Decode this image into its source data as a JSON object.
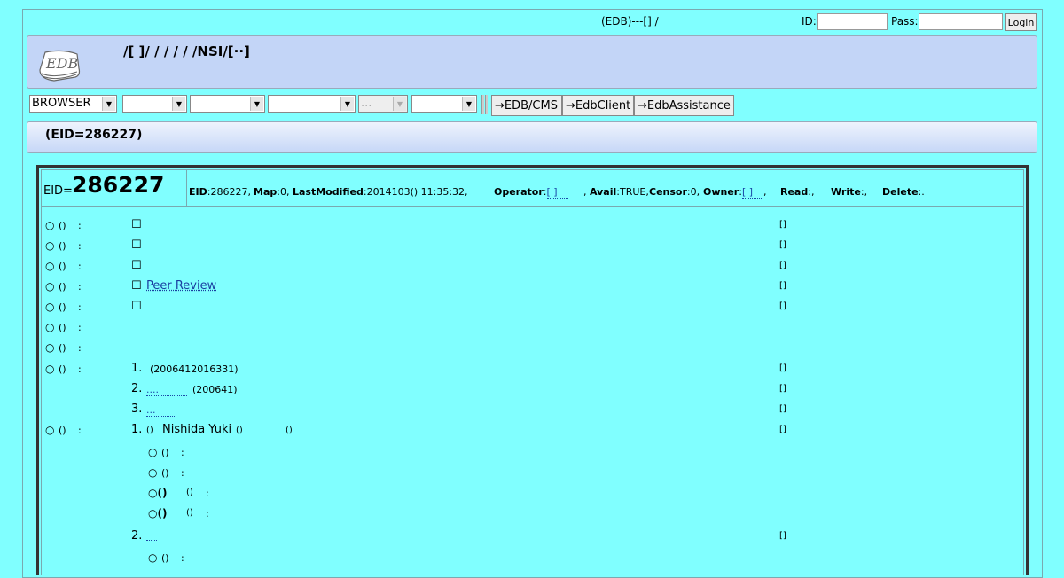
{
  "topbar": {
    "title": "(EDB)---[] /",
    "id_label": "ID:",
    "pass_label": "Pass:",
    "id_value": "",
    "pass_value": "",
    "login_label": "Login"
  },
  "header": {
    "logo_text": "EDB",
    "breadcrumb": "/[ ]/ / / / / /NSI/[··]"
  },
  "menubar": {
    "browser_select": "BROWSER",
    "select2": "",
    "select3": "",
    "select4": "",
    "select5": "...",
    "select6": "",
    "btn_cms": "→EDB/CMS",
    "btn_client": "→EdbClient",
    "btn_assist": "→EdbAssistance"
  },
  "eid_title": "(EID=286227)",
  "record": {
    "eid_prefix": "EID=",
    "eid_number": "286227",
    "meta": {
      "eid_label": "EID",
      "eid_value": ":286227,",
      "map_label": "Map",
      "map_value": ":0,",
      "modified_label": "LastModified",
      "modified_value": ":2014103() 11:35:32,",
      "operator_label": "Operator",
      "operator_value": "[ ]",
      "avail_label": "Avail",
      "avail_value": ":TRUE,",
      "censor_label": "Censor",
      "censor_value": ":0,",
      "owner_label": "Owner",
      "owner_value": "[ ]",
      "read_label": "Read",
      "read_value": ":,",
      "write_label": "Write",
      "write_value": ":,",
      "delete_label": "Delete",
      "delete_value": ":."
    },
    "rows": [
      {
        "marker": "○",
        "paren": "()",
        "colon": ":",
        "check": "☐",
        "link": "",
        "bracket": "[]"
      },
      {
        "marker": "○",
        "paren": "()",
        "colon": ":",
        "check": "☐",
        "link": "",
        "bracket": "[]"
      },
      {
        "marker": "○",
        "paren": "()",
        "colon": ":",
        "check": "☐",
        "link": "",
        "bracket": "[]"
      },
      {
        "marker": "○",
        "paren": "()",
        "colon": ":",
        "check": "☐",
        "link": "Peer Review",
        "bracket": "[]"
      },
      {
        "marker": "○",
        "paren": "()",
        "colon": ":",
        "check": "☐",
        "link": "",
        "bracket": "[]"
      },
      {
        "marker": "○",
        "paren": "()",
        "colon": ":",
        "check": "",
        "link": "",
        "bracket": ""
      },
      {
        "marker": "○",
        "paren": "()",
        "colon": ":",
        "check": "",
        "link": "",
        "bracket": ""
      }
    ],
    "list1": {
      "marker": "○",
      "paren": "()",
      "colon": ":",
      "items": [
        {
          "num": "1.",
          "link": "",
          "text": "(2006412016331)",
          "bracket": "[]"
        },
        {
          "num": "2.",
          "link": "....",
          "text": "(200641)",
          "bracket": "[]"
        },
        {
          "num": "3.",
          "link": "...",
          "text": "",
          "bracket": "[]"
        }
      ]
    },
    "list2": {
      "marker": "○",
      "paren": "()",
      "colon": ":",
      "item1": {
        "num": "1.",
        "paren": "()",
        "name": "Nishida Yuki",
        "paren2": "()",
        "paren3": "()",
        "bracket": "[]"
      },
      "subs": [
        {
          "marker": "○",
          "paren": "()",
          "colon": ":",
          "extra": ""
        },
        {
          "marker": "○",
          "paren": "()",
          "colon": ":",
          "extra": ""
        },
        {
          "marker": "○()",
          "paren": "()",
          "colon": ":",
          "extra": "bold"
        },
        {
          "marker": "○()",
          "paren": "()",
          "colon": ":",
          "extra": "bold"
        }
      ],
      "item2": {
        "num": "2.",
        "link": "....",
        "bracket": "[]"
      },
      "sub_last": {
        "marker": "○",
        "paren": "()",
        "colon": ":"
      }
    }
  }
}
